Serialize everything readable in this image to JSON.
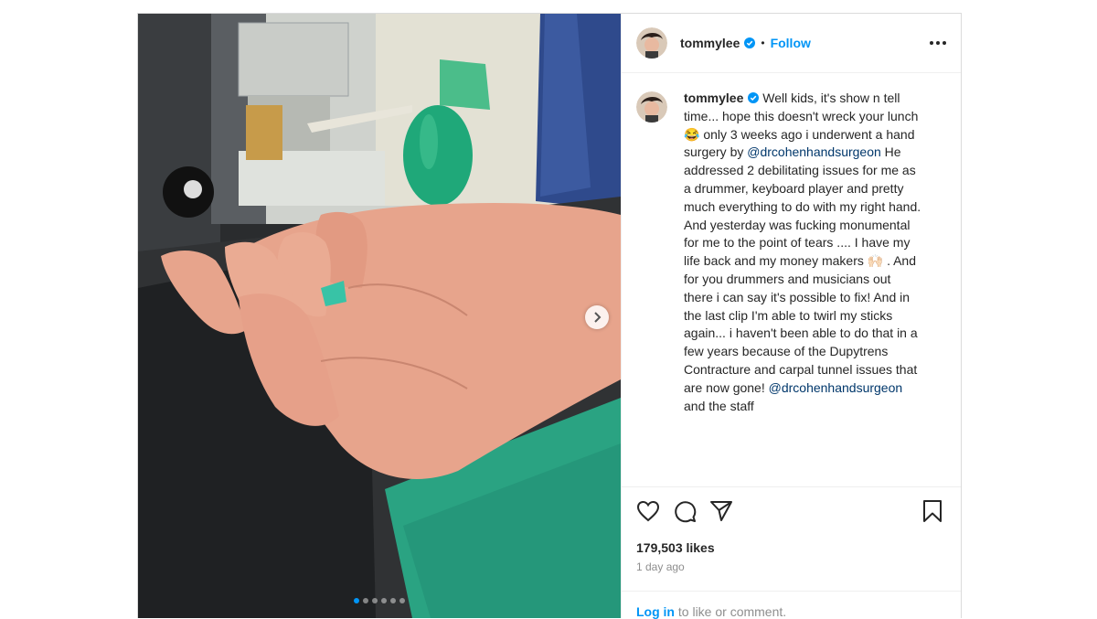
{
  "post": {
    "username": "tommylee",
    "follow_label": "Follow",
    "separator": "•",
    "caption": {
      "username": "tommylee",
      "part1": "Well kids, it's show n tell time... hope this doesn't wreck your lunch 😂 only 3 weeks ago i underwent a hand surgery by ",
      "mention1": "@drcohenhandsurgeon",
      "part2": " He addressed 2 debilitating issues for me as a drummer, keyboard player and pretty much everything to do with my right hand. And yesterday was fucking monumental for me to the point of tears .... I have my life back and my money makers 🙌🏻 . And for you drummers and musicians out there i can say it's possible to fix! And in the last clip I'm able to twirl my sticks again... i haven't been able to do that in a few years because of the Dupytrens Contracture and carpal tunnel issues that are now gone! ",
      "mention2": "@drcohenhandsurgeon",
      "part3": " and the staff"
    },
    "likes": "179,503 likes",
    "time": "1 day ago",
    "login_link": "Log in",
    "login_rest": " to like or comment.",
    "carousel": {
      "total": 6,
      "current": 1
    }
  },
  "icons": {
    "verified": "verified-badge-icon",
    "more": "more-options-icon",
    "like": "heart-icon",
    "comment": "comment-icon",
    "share": "share-icon",
    "save": "bookmark-icon",
    "next": "chevron-right-icon"
  },
  "colors": {
    "accent": "#0095f6",
    "mention": "#00376b",
    "muted": "#8e8e8e",
    "text": "#262626"
  }
}
